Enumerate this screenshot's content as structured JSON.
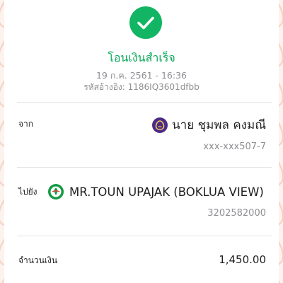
{
  "header": {
    "status_title": "โอนเงินสำเร็จ",
    "datetime": "19 ก.ค. 2561 - 16:36",
    "reference": "รหัสอ้างอิง: 1186IQ3601dfbb"
  },
  "from": {
    "label": "จาก",
    "name": "นาย ชุมพล คงมณี",
    "account": "xxx-xxx507-7",
    "bank_icon": "purple-bank-icon"
  },
  "to": {
    "label": "ไปยัง",
    "name": "MR.TOUN UPAJAK (BOKLUA VIEW)",
    "account": "3202582000",
    "bank_icon": "green-bank-icon"
  },
  "amount": {
    "label": "จำนวนเงิน",
    "value": "1,450.00"
  },
  "colors": {
    "success": "#12b563",
    "background": "#fdf3ee",
    "pattern": "#f6d9cc"
  },
  "icons": {
    "status": "check-circle-icon"
  }
}
